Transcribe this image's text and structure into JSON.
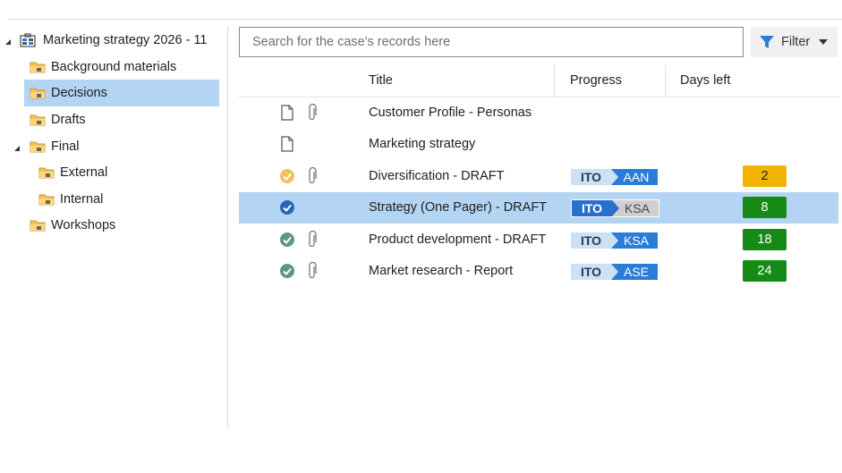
{
  "tree": {
    "root_label": "Marketing strategy 2026 - 11",
    "items": [
      {
        "label": "Background materials"
      },
      {
        "label": "Decisions"
      },
      {
        "label": "Drafts"
      },
      {
        "label": "Final"
      },
      {
        "label": "External"
      },
      {
        "label": "Internal"
      },
      {
        "label": "Workshops"
      }
    ]
  },
  "search": {
    "placeholder": "Search for the case's records here",
    "value": ""
  },
  "filter": {
    "label": "Filter"
  },
  "columns": {
    "title": "Title",
    "progress": "Progress",
    "days_left": "Days left"
  },
  "rows": [
    {
      "title": "Customer Profile - Personas",
      "icon": "document-icon",
      "attachment": true
    },
    {
      "title": "Marketing strategy",
      "icon": "document-icon",
      "attachment": false
    },
    {
      "title": "Diversification - DRAFT",
      "icon": "check-circle-icon",
      "attachment": true,
      "progress_from": "ITO",
      "progress_to": "AAN",
      "days": "2",
      "days_color": "#f0b400"
    },
    {
      "title": "Strategy (One Pager) - DRAFT",
      "icon": "check-circle-icon",
      "attachment": false,
      "progress_from": "ITO",
      "progress_to": "KSA",
      "days": "8",
      "days_color": "#168a16"
    },
    {
      "title": "Product development - DRAFT",
      "icon": "check-circle-icon",
      "attachment": true,
      "progress_from": "ITO",
      "progress_to": "KSA",
      "days": "18",
      "days_color": "#168a16"
    },
    {
      "title": "Market research - Report",
      "icon": "check-circle-icon",
      "attachment": true,
      "progress_from": "ITO",
      "progress_to": "ASE",
      "days": "24",
      "days_color": "#168a16"
    }
  ],
  "colors": {
    "selection": "#b3d4f2",
    "accent": "#2a7dd6",
    "days_yellow": "#f0b400",
    "days_green": "#168a16"
  }
}
